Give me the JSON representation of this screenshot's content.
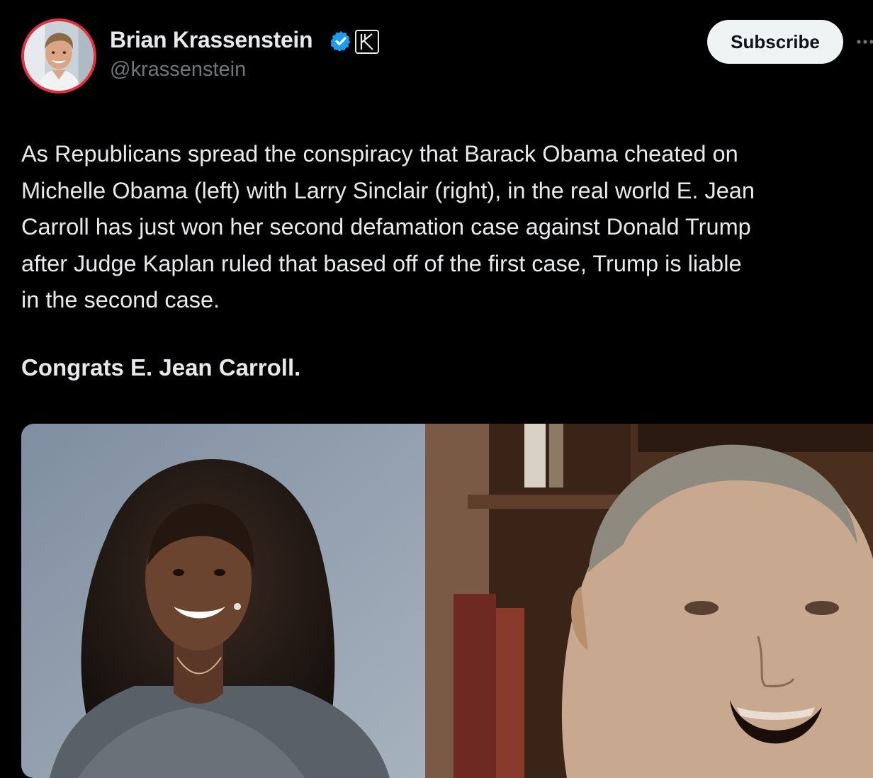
{
  "author": {
    "display_name": "Brian Krassenstein",
    "handle": "@krassenstein",
    "verified_color": "#1d9bf0",
    "avatar_ring_color": "#e0313f",
    "affiliate_badge_glyph": "K"
  },
  "actions": {
    "subscribe_label": "Subscribe",
    "more_icon": "more-horizontal-icon"
  },
  "post": {
    "lines": [
      "As Republicans spread the conspiracy that Barack Obama cheated on",
      "Michelle Obama (left) with Larry Sinclair (right), in the real world E. Jean",
      "Carroll has just won her second defamation case against Donald Trump",
      "after Judge Kaplan ruled that based off of the first case, Trump is liable",
      "in the second case."
    ],
    "congrats": "Congrats E. Jean Carroll."
  },
  "colors": {
    "background": "#000000",
    "text": "#e7e9ea",
    "secondary_text": "#71767b",
    "subscribe_bg": "#eff3f4"
  }
}
